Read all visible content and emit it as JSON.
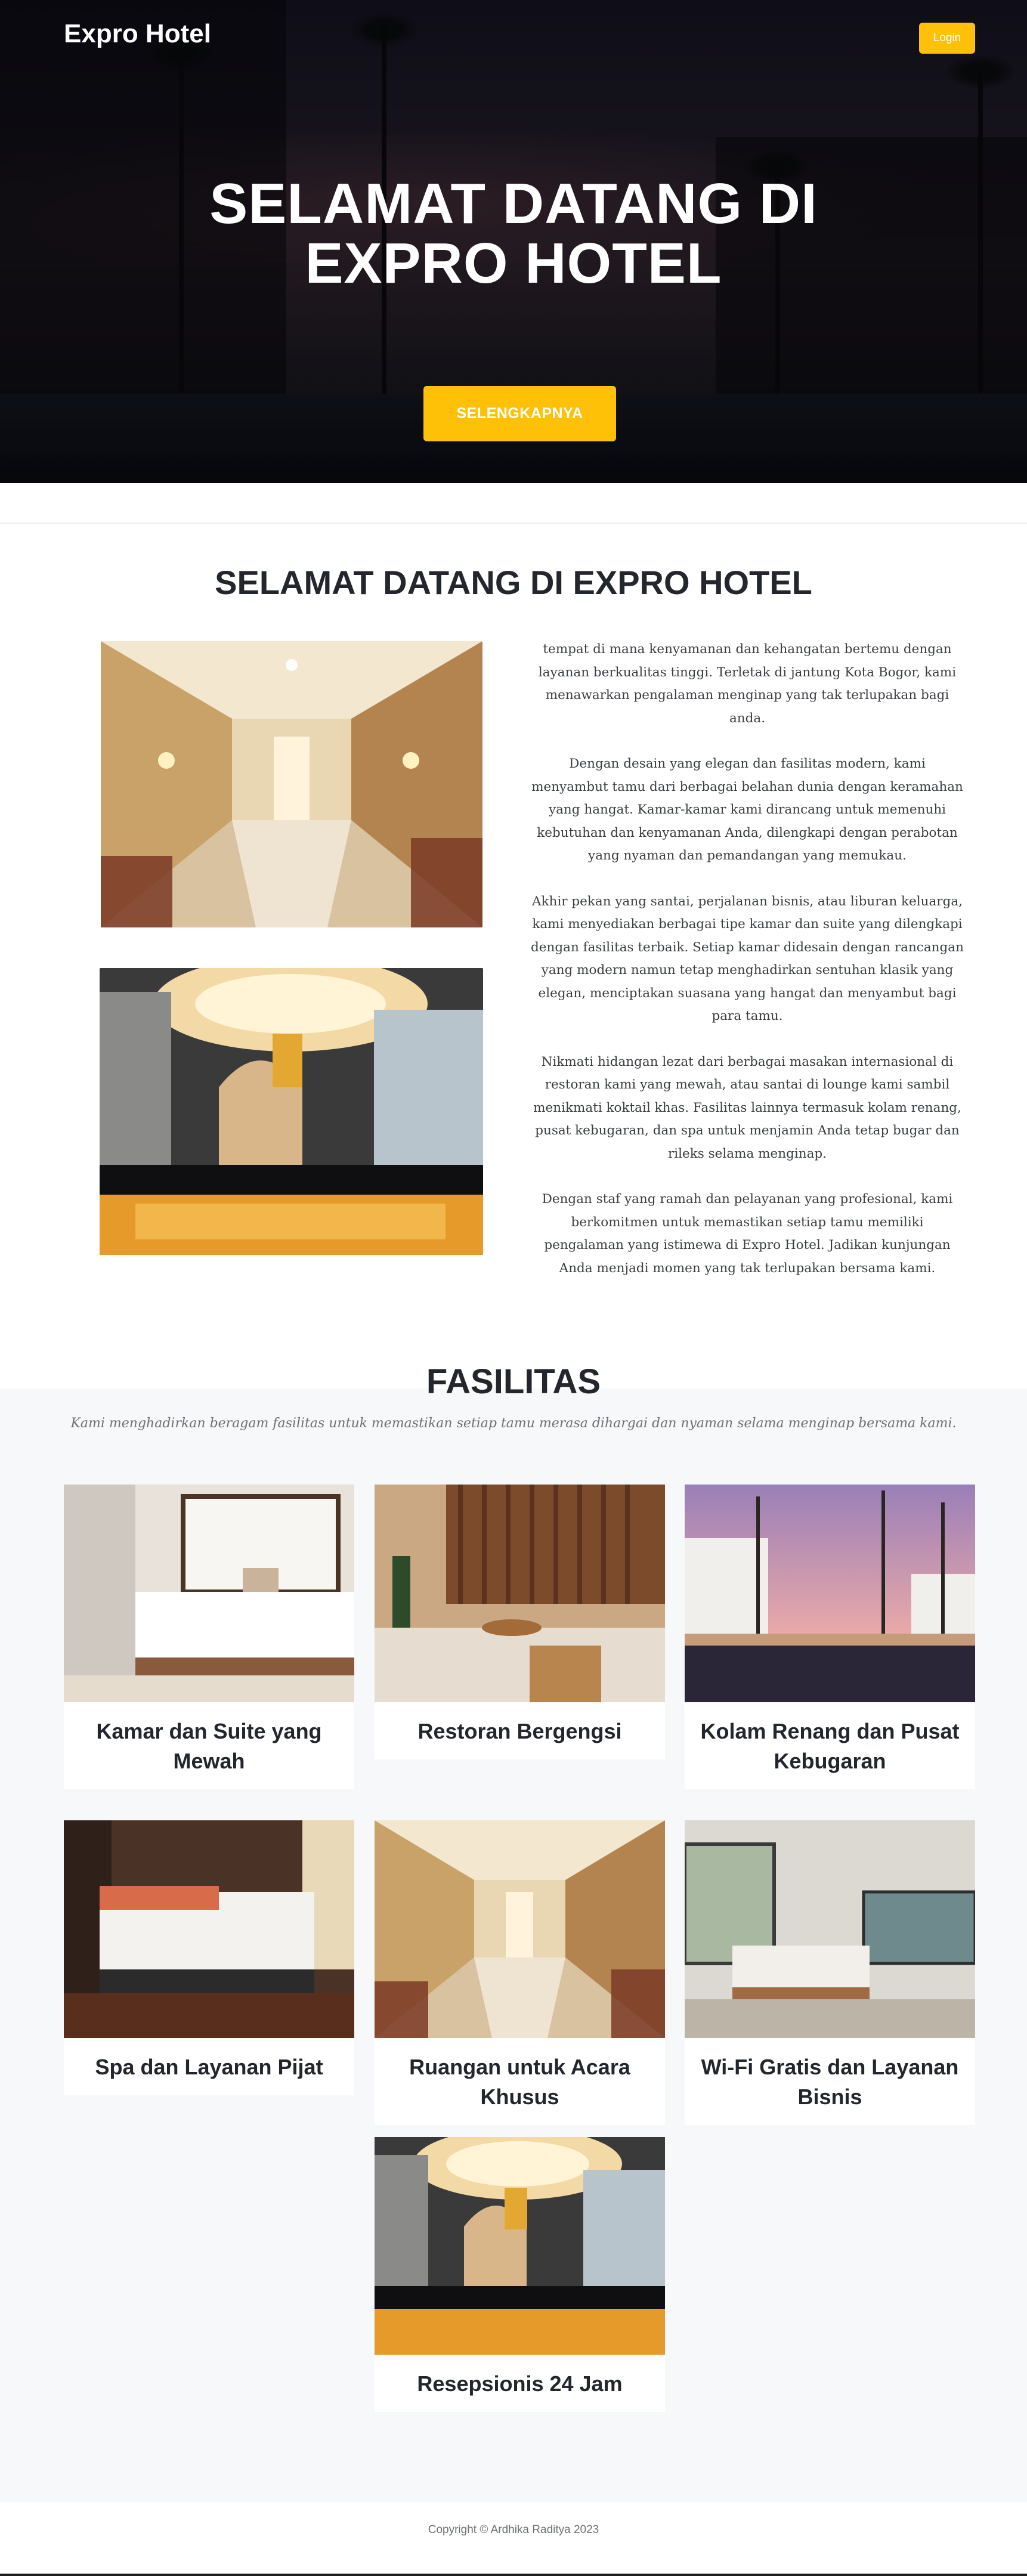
{
  "navbar": {
    "brand": "Expro Hotel",
    "login_label": "Login"
  },
  "hero": {
    "title_line1": "SELAMAT DATANG DI",
    "title_line2": "EXPRO HOTEL",
    "cta_label": "SELENGKAPNYA"
  },
  "about": {
    "title": "SELAMAT DATANG DI EXPRO HOTEL",
    "paragraphs": [
      "tempat di mana kenyamanan dan kehangatan bertemu dengan layanan berkualitas tinggi. Terletak di jantung Kota Bogor, kami menawarkan pengalaman menginap yang tak terlupakan bagi anda.",
      "Dengan desain yang elegan dan fasilitas modern, kami menyambut tamu dari berbagai belahan dunia dengan keramahan yang hangat. Kamar-kamar kami dirancang untuk memenuhi kebutuhan dan kenyamanan Anda, dilengkapi dengan perabotan yang nyaman dan pemandangan yang memukau.",
      "Akhir pekan yang santai, perjalanan bisnis, atau liburan keluarga, kami menyediakan berbagai tipe kamar dan suite yang dilengkapi dengan fasilitas terbaik. Setiap kamar didesain dengan rancangan yang modern namun tetap menghadirkan sentuhan klasik yang elegan, menciptakan suasana yang hangat dan menyambut bagi para tamu.",
      "Nikmati hidangan lezat dari berbagai masakan internasional di restoran kami yang mewah, atau santai di lounge kami sambil menikmati koktail khas. Fasilitas lainnya termasuk kolam renang, pusat kebugaran, dan spa untuk menjamin Anda tetap bugar dan rileks selama menginap.",
      "Dengan staf yang ramah dan pelayanan yang profesional, kami berkomitmen untuk memastikan setiap tamu memiliki pengalaman yang istimewa di Expro Hotel. Jadikan kunjungan Anda menjadi momen yang tak terlupakan bersama kami."
    ]
  },
  "facilities": {
    "title": "FASILITAS",
    "subtitle": "Kami menghadirkan beragam fasilitas untuk memastikan setiap tamu merasa dihargai dan nyaman selama menginap bersama kami.",
    "items": [
      {
        "label": "Kamar dan Suite yang Mewah",
        "image": "bedroom-photo"
      },
      {
        "label": "Restoran Bergengsi",
        "image": "restaurant-photo"
      },
      {
        "label": "Kolam Renang dan Pusat Kebugaran",
        "image": "pool-photo"
      },
      {
        "label": "Spa dan Layanan Pijat",
        "image": "spa-bedroom-photo"
      },
      {
        "label": "Ruangan untuk Acara Khusus",
        "image": "hallway-photo"
      },
      {
        "label": "Wi-Fi Gratis dan Layanan Bisnis",
        "image": "modern-suite-photo"
      },
      {
        "label": "Resepsionis 24 Jam",
        "image": "lobby-photo"
      }
    ]
  },
  "footer": {
    "copyright": "Copyright © Ardhika Raditya 2023"
  },
  "colors": {
    "accent": "#ffc107",
    "heading": "#23262d",
    "section_bg": "#f7f8fa"
  }
}
